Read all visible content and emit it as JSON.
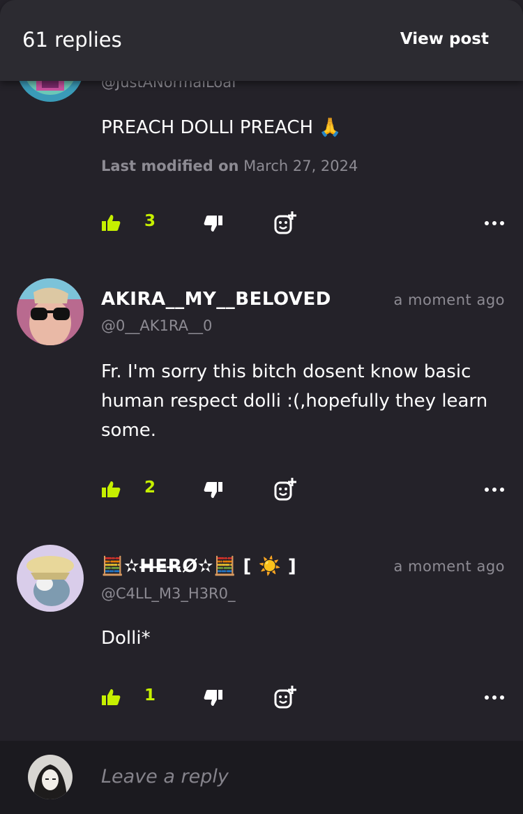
{
  "header": {
    "replies_count": "61 replies",
    "view_post": "View post"
  },
  "comments": [
    {
      "username": "",
      "handle": "@JustANormalLoaf",
      "time": "",
      "body": "PREACH DOLLI PREACH 🙏",
      "modified_label": "Last modified on",
      "modified_date": "March 27, 2024",
      "likes": "3"
    },
    {
      "username": "AKIRA__MY__BELOVED",
      "handle": "@0__AK1RA__0",
      "time": "a moment ago",
      "body": "Fr. I'm sorry this bitch dosent know basic human respect dolli :(,hopefully they learn some.",
      "likes": "2"
    },
    {
      "username": "🧮✫H̶E̶R̶Ø✫🧮 [ ☀️ ]",
      "handle": "@C4LL_M3_H3R0_",
      "time": "a moment ago",
      "body": "Dolli*",
      "likes": "1"
    }
  ],
  "footer": {
    "reply_placeholder": "Leave a reply"
  },
  "colors": {
    "accent": "#c6f000",
    "background": "#242229",
    "muted": "#8d8b93"
  }
}
